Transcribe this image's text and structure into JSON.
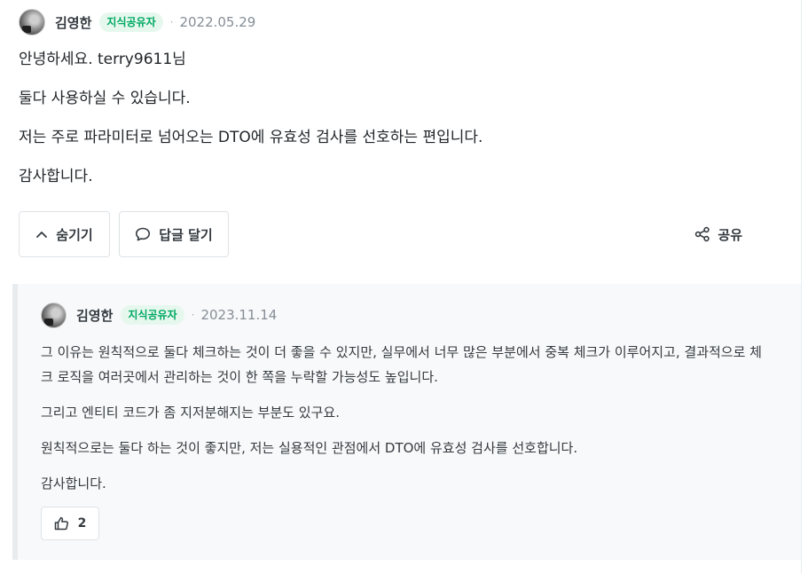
{
  "answer": {
    "author": "김영한",
    "badge": "지식공유자",
    "separator": "·",
    "date": "2022.05.29",
    "paragraphs": [
      "안녕하세요. terry9611님",
      "둘다 사용하실 수 있습니다.",
      "저는 주로 파라미터로 넘어오는 DTO에 유효성 검사를 선호하는 편입니다.",
      "감사합니다."
    ],
    "actions": {
      "hide_label": "숨기기",
      "reply_label": "답글 달기",
      "share_label": "공유"
    }
  },
  "reply": {
    "author": "김영한",
    "badge": "지식공유자",
    "separator": "·",
    "date": "2023.11.14",
    "paragraphs": [
      "그 이유는 원칙적으로 둘다 체크하는 것이 더 좋을 수 있지만, 실무에서 너무 많은 부분에서 중복 체크가 이루어지고, 결과적으로 체크 로직을 여러곳에서 관리하는 것이 한 쪽을 누락할 가능성도 높입니다.",
      "그리고 엔티티 코드가 좀 지저분해지는 부분도 있구요.",
      "원칙적으로는 둘다 하는 것이 좋지만, 저는 실용적인 관점에서 DTO에 유효성 검사를 선호합니다.",
      "감사합니다."
    ],
    "like_count": "2"
  },
  "icons": {
    "hide": "chevron-up-icon",
    "reply": "speech-bubble-icon",
    "share": "share-icon",
    "like": "thumbs-up-icon"
  },
  "colors": {
    "badge_bg": "#e6f8ee",
    "badge_text": "#00a862",
    "date": "#868e96",
    "reply_bg": "#f8f9fa"
  }
}
